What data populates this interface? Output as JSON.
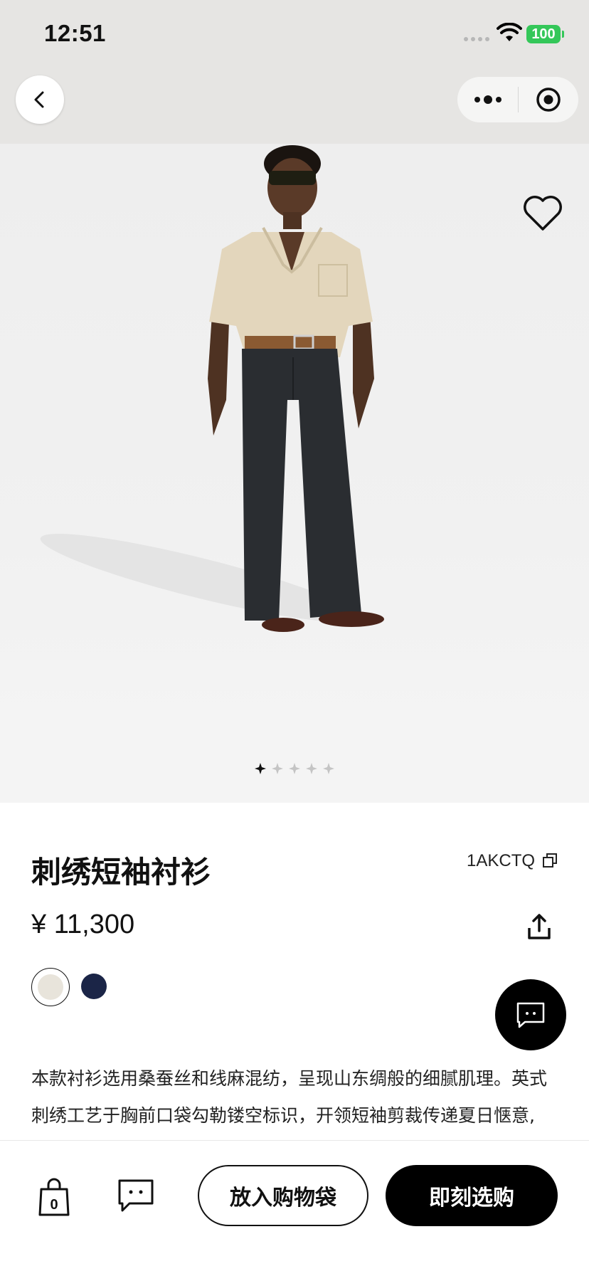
{
  "status_bar": {
    "time": "12:51",
    "battery": "100"
  },
  "nav": {
    "back_icon": "chevron-left-icon",
    "more_icon": "more-dots-icon",
    "close_icon": "target-close-icon"
  },
  "product": {
    "title": "刺绣短袖衬衫",
    "sku": "1AKCTQ",
    "price": "¥ 11,300",
    "carousel": {
      "count": 5,
      "active_index": 0
    },
    "swatches": [
      {
        "name": "cream",
        "color": "#e8e4db",
        "selected": true
      },
      {
        "name": "navy",
        "color": "#1b2547",
        "selected": false
      }
    ],
    "description_lines": [
      "本款衬衫选用桑蚕丝和线麻混纺，呈现山东绸般的细腻肌理。英式",
      "刺绣工艺于胸前口袋勾勒镂空标识，开领短袖剪裁传递夏日惬意,"
    ]
  },
  "bottom_bar": {
    "bag_count": "0",
    "add_to_bag_label": "放入购物袋",
    "buy_now_label": "即刻选购"
  },
  "colors": {
    "accent": "#000000",
    "battery_green": "#34c759",
    "header_bg": "#e6e5e3"
  }
}
